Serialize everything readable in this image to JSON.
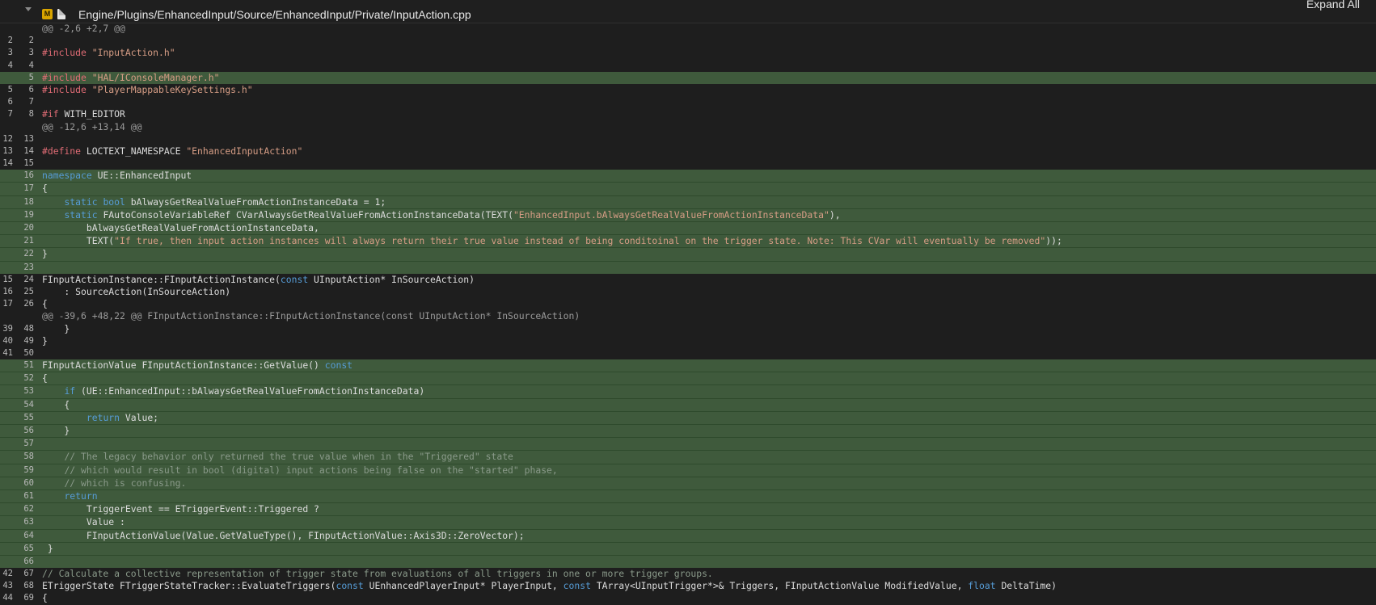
{
  "header": {
    "badge": "M",
    "path": "Engine/Plugins/EnhancedInput/Source/EnhancedInput/Private/InputAction.cpp",
    "expand_label": "Expand All"
  },
  "colors": {
    "added": "#3f5a3c",
    "keyword": "#569cd6",
    "preproc": "#e06c75",
    "string": "#d69d85",
    "comment": "#8a9a8a"
  },
  "lines": [
    {
      "o": "",
      "n": "",
      "t": "hunk",
      "toks": [
        [
          "hunk",
          "@@ -2,6 +2,7 @@"
        ]
      ]
    },
    {
      "o": "2",
      "n": "2",
      "t": "ctx",
      "toks": []
    },
    {
      "o": "3",
      "n": "3",
      "t": "ctx",
      "toks": [
        [
          "pp",
          "#include "
        ],
        [
          "str",
          "\"InputAction.h\""
        ]
      ]
    },
    {
      "o": "4",
      "n": "4",
      "t": "ctx",
      "toks": []
    },
    {
      "o": "",
      "n": "5",
      "t": "add",
      "toks": [
        [
          "pp",
          "#include "
        ],
        [
          "str",
          "\"HAL/IConsoleManager.h\""
        ]
      ]
    },
    {
      "o": "5",
      "n": "6",
      "t": "ctx",
      "toks": [
        [
          "pp",
          "#include "
        ],
        [
          "str",
          "\"PlayerMappableKeySettings.h\""
        ]
      ]
    },
    {
      "o": "6",
      "n": "7",
      "t": "ctx",
      "toks": []
    },
    {
      "o": "7",
      "n": "8",
      "t": "ctx",
      "toks": [
        [
          "pp",
          "#if "
        ],
        [
          "plain",
          "WITH_EDITOR"
        ]
      ]
    },
    {
      "o": "",
      "n": "",
      "t": "hunk",
      "toks": [
        [
          "hunk",
          "@@ -12,6 +13,14 @@"
        ]
      ]
    },
    {
      "o": "12",
      "n": "13",
      "t": "ctx",
      "toks": []
    },
    {
      "o": "13",
      "n": "14",
      "t": "ctx",
      "toks": [
        [
          "pp",
          "#define "
        ],
        [
          "plain",
          "LOCTEXT_NAMESPACE "
        ],
        [
          "str",
          "\"EnhancedInputAction\""
        ]
      ]
    },
    {
      "o": "14",
      "n": "15",
      "t": "ctx",
      "toks": []
    },
    {
      "o": "",
      "n": "16",
      "t": "add",
      "toks": [
        [
          "kw",
          "namespace "
        ],
        [
          "plain",
          "UE::EnhancedInput"
        ]
      ]
    },
    {
      "o": "",
      "n": "17",
      "t": "add",
      "toks": [
        [
          "plain",
          "{"
        ]
      ]
    },
    {
      "o": "",
      "n": "18",
      "t": "add",
      "toks": [
        [
          "plain",
          "    "
        ],
        [
          "kw",
          "static bool "
        ],
        [
          "plain",
          "bAlwaysGetRealValueFromActionInstanceData = 1;"
        ]
      ]
    },
    {
      "o": "",
      "n": "19",
      "t": "add",
      "toks": [
        [
          "plain",
          "    "
        ],
        [
          "kw",
          "static "
        ],
        [
          "plain",
          "FAutoConsoleVariableRef CVarAlwaysGetRealValueFromActionInstanceData(TEXT("
        ],
        [
          "str",
          "\"EnhancedInput.bAlwaysGetRealValueFromActionInstanceData\""
        ],
        [
          "plain",
          "),"
        ]
      ]
    },
    {
      "o": "",
      "n": "20",
      "t": "add",
      "toks": [
        [
          "plain",
          "        bAlwaysGetRealValueFromActionInstanceData,"
        ]
      ]
    },
    {
      "o": "",
      "n": "21",
      "t": "add",
      "toks": [
        [
          "plain",
          "        TEXT("
        ],
        [
          "str",
          "\"If true, then input action instances will always return their true value instead of being conditoinal on the trigger state. Note: This CVar will eventually be removed\""
        ],
        [
          "plain",
          "));"
        ]
      ]
    },
    {
      "o": "",
      "n": "22",
      "t": "add",
      "toks": [
        [
          "plain",
          "}"
        ]
      ]
    },
    {
      "o": "",
      "n": "23",
      "t": "add",
      "toks": []
    },
    {
      "o": "15",
      "n": "24",
      "t": "ctx",
      "toks": [
        [
          "plain",
          "FInputActionInstance::FInputActionInstance("
        ],
        [
          "kw",
          "const "
        ],
        [
          "plain",
          "UInputAction* InSourceAction)"
        ]
      ]
    },
    {
      "o": "16",
      "n": "25",
      "t": "ctx",
      "toks": [
        [
          "plain",
          "    : SourceAction(InSourceAction)"
        ]
      ]
    },
    {
      "o": "17",
      "n": "26",
      "t": "ctx",
      "toks": [
        [
          "plain",
          "{"
        ]
      ]
    },
    {
      "o": "",
      "n": "",
      "t": "hunk",
      "toks": [
        [
          "hunk",
          "@@ -39,6 +48,22 @@ FInputActionInstance::FInputActionInstance(const UInputAction* InSourceAction)"
        ]
      ]
    },
    {
      "o": "39",
      "n": "48",
      "t": "ctx",
      "toks": [
        [
          "plain",
          "    }"
        ]
      ]
    },
    {
      "o": "40",
      "n": "49",
      "t": "ctx",
      "toks": [
        [
          "plain",
          "}"
        ]
      ]
    },
    {
      "o": "41",
      "n": "50",
      "t": "ctx",
      "toks": []
    },
    {
      "o": "",
      "n": "51",
      "t": "add",
      "toks": [
        [
          "plain",
          "FInputActionValue FInputActionInstance::GetValue() "
        ],
        [
          "kw",
          "const"
        ]
      ]
    },
    {
      "o": "",
      "n": "52",
      "t": "add",
      "toks": [
        [
          "plain",
          "{"
        ]
      ]
    },
    {
      "o": "",
      "n": "53",
      "t": "add",
      "toks": [
        [
          "plain",
          "    "
        ],
        [
          "kw",
          "if "
        ],
        [
          "plain",
          "(UE::EnhancedInput::bAlwaysGetRealValueFromActionInstanceData)"
        ]
      ]
    },
    {
      "o": "",
      "n": "54",
      "t": "add",
      "toks": [
        [
          "plain",
          "    {"
        ]
      ]
    },
    {
      "o": "",
      "n": "55",
      "t": "add",
      "toks": [
        [
          "plain",
          "        "
        ],
        [
          "kw",
          "return "
        ],
        [
          "plain",
          "Value;"
        ]
      ]
    },
    {
      "o": "",
      "n": "56",
      "t": "add",
      "toks": [
        [
          "plain",
          "    }"
        ]
      ]
    },
    {
      "o": "",
      "n": "57",
      "t": "add",
      "toks": []
    },
    {
      "o": "",
      "n": "58",
      "t": "add",
      "toks": [
        [
          "plain",
          "    "
        ],
        [
          "com",
          "// The legacy behavior only returned the true value when in the \"Triggered\" state"
        ]
      ]
    },
    {
      "o": "",
      "n": "59",
      "t": "add",
      "toks": [
        [
          "plain",
          "    "
        ],
        [
          "com",
          "// which would result in bool (digital) input actions being false on the \"started\" phase,"
        ]
      ]
    },
    {
      "o": "",
      "n": "60",
      "t": "add",
      "toks": [
        [
          "plain",
          "    "
        ],
        [
          "com",
          "// which is confusing."
        ]
      ]
    },
    {
      "o": "",
      "n": "61",
      "t": "add",
      "toks": [
        [
          "plain",
          "    "
        ],
        [
          "kw",
          "return"
        ]
      ]
    },
    {
      "o": "",
      "n": "62",
      "t": "add",
      "toks": [
        [
          "plain",
          "        TriggerEvent == ETriggerEvent::Triggered ?"
        ]
      ]
    },
    {
      "o": "",
      "n": "63",
      "t": "add",
      "toks": [
        [
          "plain",
          "        Value :"
        ]
      ]
    },
    {
      "o": "",
      "n": "64",
      "t": "add",
      "toks": [
        [
          "plain",
          "        FInputActionValue(Value.GetValueType(), FInputActionValue::Axis3D::ZeroVector);"
        ]
      ]
    },
    {
      "o": "",
      "n": "65",
      "t": "add",
      "toks": [
        [
          "plain",
          " }"
        ]
      ]
    },
    {
      "o": "",
      "n": "66",
      "t": "add",
      "toks": []
    },
    {
      "o": "42",
      "n": "67",
      "t": "ctx",
      "toks": [
        [
          "com",
          "// Calculate a collective representation of trigger state from evaluations of all triggers in one or more trigger groups."
        ]
      ]
    },
    {
      "o": "43",
      "n": "68",
      "t": "ctx",
      "toks": [
        [
          "plain",
          "ETriggerState FTriggerStateTracker::EvaluateTriggers("
        ],
        [
          "kw",
          "const "
        ],
        [
          "plain",
          "UEnhancedPlayerInput* PlayerInput, "
        ],
        [
          "kw",
          "const "
        ],
        [
          "plain",
          "TArray<UInputTrigger*>& Triggers, FInputActionValue ModifiedValue, "
        ],
        [
          "kw",
          "float "
        ],
        [
          "plain",
          "DeltaTime)"
        ]
      ]
    },
    {
      "o": "44",
      "n": "69",
      "t": "ctx",
      "toks": [
        [
          "plain",
          "{"
        ]
      ]
    }
  ]
}
